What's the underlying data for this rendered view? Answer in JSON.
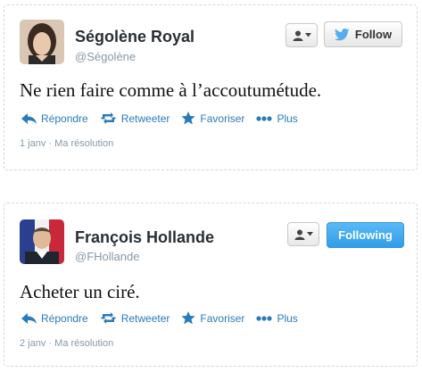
{
  "tweets": [
    {
      "name": "Ségolène Royal",
      "handle": "@Ségolène",
      "text": "Ne rien faire comme à l’accoutumétude.",
      "follow_label": "Follow",
      "follow_state": "not-following",
      "actions": {
        "reply": "Répondre",
        "retweet": "Retweeter",
        "favorite": "Favoriser",
        "more": "Plus"
      },
      "date": "1 janv",
      "separator": "·",
      "source": "Ma résolution"
    },
    {
      "name": "François Hollande",
      "handle": "@FHollande",
      "text": "Acheter un ciré.",
      "follow_label": "Following",
      "follow_state": "following",
      "actions": {
        "reply": "Répondre",
        "retweet": "Retweeter",
        "favorite": "Favoriser",
        "more": "Plus"
      },
      "date": "2 janv",
      "separator": "·",
      "source": "Ma résolution"
    }
  ],
  "colors": {
    "link": "#2b7bb9",
    "following_bg": "#2f9ee8",
    "twitter_bird": "#55acee",
    "muted": "#8899a6"
  },
  "icons": [
    "reply-icon",
    "retweet-icon",
    "favorite-star-icon",
    "more-dots-icon",
    "user-icon",
    "twitter-bird-icon"
  ]
}
